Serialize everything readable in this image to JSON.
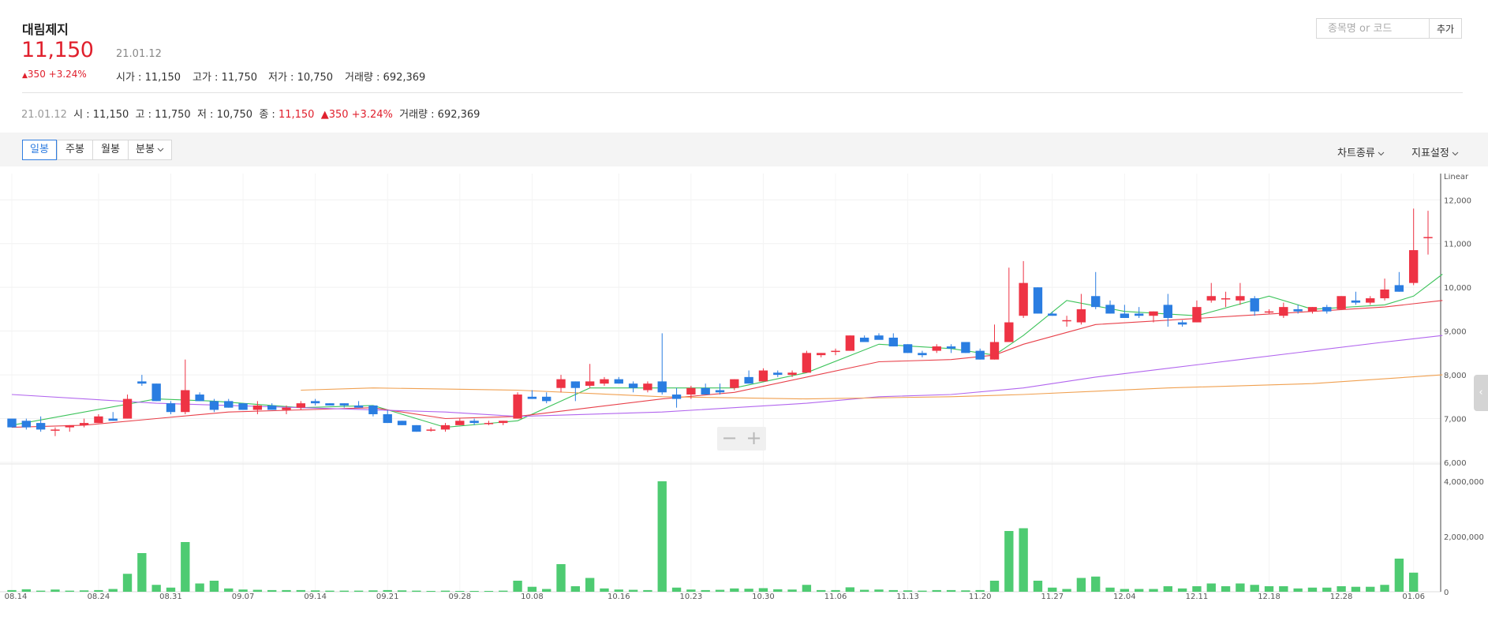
{
  "header": {
    "stock_name": "대림제지",
    "price": "11,150",
    "date": "21.01.12",
    "change_arrow": "▲",
    "change_text": "350 +3.24%",
    "stats": [
      {
        "label": "시가",
        "value": "11,150"
      },
      {
        "label": "고가",
        "value": "11,750"
      },
      {
        "label": "저가",
        "value": "10,750"
      },
      {
        "label": "거래량",
        "value": "692,369"
      }
    ]
  },
  "search": {
    "placeholder": "종목명 or 코드",
    "value": "",
    "add_label": "추가"
  },
  "quote_line": {
    "date": "21.01.12",
    "open_label": "시",
    "open": "11,150",
    "high_label": "고",
    "high": "11,750",
    "low_label": "저",
    "low": "10,750",
    "close_label": "종",
    "close": "11,150",
    "arrow": "▲",
    "change": "350 +3.24%",
    "volume_label": "거래량",
    "volume": "692,369"
  },
  "toolbar": {
    "periods": [
      "일봉",
      "주봉",
      "월봉",
      "분봉"
    ],
    "active_period": "일봉",
    "chart_type_label": "차트종류",
    "indicator_label": "지표설정"
  },
  "colors": {
    "up": "#ee3344",
    "down": "#2a7de1",
    "ma5": "#3cc35a",
    "ma20": "#e8404a",
    "ma60": "#b266ee",
    "ma120": "#f0a050",
    "volume": "#4ecb72",
    "active": "#2f7de1"
  },
  "icons": {
    "dropdown": "chevron-down-icon",
    "zoom_out": "minus-icon",
    "zoom_in": "plus-icon",
    "side": "chevron-left-icon"
  },
  "zoom": {
    "minus": "−",
    "plus": "+"
  },
  "side_handle": "‹",
  "chart_data": {
    "type": "candlestick",
    "scale_label": "Linear",
    "price_axis": {
      "min": 6000,
      "max": 12600,
      "ticks": [
        "12,000",
        "11,000",
        "10,000",
        "9,000",
        "8,000",
        "7,000",
        "6,000"
      ]
    },
    "volume_axis": {
      "min": 0,
      "max": 4000000,
      "ticks": [
        "4,000,000",
        "2,000,000",
        "0"
      ]
    },
    "x_ticks": [
      "08.14",
      "08.24",
      "08.31",
      "09.07",
      "09.14",
      "09.21",
      "09.28",
      "10.08",
      "10.16",
      "10.23",
      "10.30",
      "11.06",
      "11.13",
      "11.20",
      "11.27",
      "12.04",
      "12.11",
      "12.18",
      "12.28",
      "01.06"
    ],
    "x_tick_index": [
      0,
      6,
      11,
      16,
      21,
      26,
      31,
      36,
      42,
      47,
      52,
      57,
      62,
      67,
      72,
      77,
      82,
      87,
      92,
      97
    ],
    "candles": [
      [
        7000,
        7000,
        6800,
        6800
      ],
      [
        6950,
        7000,
        6750,
        6800
      ],
      [
        6900,
        7050,
        6700,
        6750
      ],
      [
        6750,
        6800,
        6600,
        6750
      ],
      [
        6800,
        6850,
        6700,
        6850
      ],
      [
        6850,
        7000,
        6800,
        6900
      ],
      [
        6900,
        7100,
        6900,
        7050
      ],
      [
        7000,
        7150,
        6950,
        6950
      ],
      [
        7000,
        7550,
        7000,
        7450
      ],
      [
        7850,
        8000,
        7750,
        7800
      ],
      [
        7800,
        7800,
        7400,
        7400
      ],
      [
        7350,
        7400,
        7100,
        7150
      ],
      [
        7150,
        8350,
        7100,
        7650
      ],
      [
        7550,
        7600,
        7400,
        7400
      ],
      [
        7400,
        7450,
        7150,
        7200
      ],
      [
        7400,
        7450,
        7250,
        7250
      ],
      [
        7350,
        7350,
        7200,
        7200
      ],
      [
        7200,
        7400,
        7100,
        7300
      ],
      [
        7300,
        7350,
        7200,
        7200
      ],
      [
        7200,
        7300,
        7100,
        7250
      ],
      [
        7250,
        7400,
        7200,
        7350
      ],
      [
        7400,
        7450,
        7300,
        7350
      ],
      [
        7350,
        7350,
        7300,
        7300
      ],
      [
        7350,
        7350,
        7250,
        7300
      ],
      [
        7300,
        7400,
        7250,
        7250
      ],
      [
        7300,
        7300,
        7050,
        7100
      ],
      [
        7100,
        7200,
        6900,
        6900
      ],
      [
        6950,
        6950,
        6850,
        6850
      ],
      [
        6850,
        6850,
        6700,
        6700
      ],
      [
        6750,
        6800,
        6700,
        6750
      ],
      [
        6750,
        6900,
        6700,
        6850
      ],
      [
        6850,
        7000,
        6850,
        6950
      ],
      [
        6950,
        7000,
        6850,
        6900
      ],
      [
        6900,
        6950,
        6850,
        6900
      ],
      [
        6900,
        6950,
        6850,
        6950
      ],
      [
        7000,
        7600,
        7000,
        7550
      ],
      [
        7500,
        7650,
        7450,
        7450
      ],
      [
        7500,
        7600,
        7350,
        7400
      ],
      [
        7700,
        8000,
        7600,
        7900
      ],
      [
        7850,
        7850,
        7400,
        7700
      ],
      [
        7750,
        8250,
        7700,
        7850
      ],
      [
        7800,
        7950,
        7750,
        7900
      ],
      [
        7900,
        7950,
        7800,
        7800
      ],
      [
        7800,
        7850,
        7600,
        7700
      ],
      [
        7650,
        7850,
        7600,
        7800
      ],
      [
        7850,
        8950,
        7550,
        7600
      ],
      [
        7550,
        7700,
        7250,
        7450
      ],
      [
        7550,
        7750,
        7450,
        7700
      ],
      [
        7700,
        7800,
        7550,
        7550
      ],
      [
        7650,
        7800,
        7550,
        7600
      ],
      [
        7700,
        7900,
        7650,
        7900
      ],
      [
        7950,
        8100,
        7800,
        7800
      ],
      [
        7850,
        8150,
        7850,
        8100
      ],
      [
        8050,
        8100,
        7950,
        8000
      ],
      [
        8000,
        8100,
        7950,
        8050
      ],
      [
        8050,
        8550,
        8050,
        8500
      ],
      [
        8450,
        8500,
        8400,
        8500
      ],
      [
        8550,
        8600,
        8450,
        8550
      ],
      [
        8550,
        8900,
        8550,
        8900
      ],
      [
        8850,
        8900,
        8750,
        8750
      ],
      [
        8900,
        8950,
        8850,
        8800
      ],
      [
        8850,
        8950,
        8650,
        8650
      ],
      [
        8700,
        8700,
        8500,
        8500
      ],
      [
        8500,
        8550,
        8400,
        8450
      ],
      [
        8550,
        8700,
        8500,
        8650
      ],
      [
        8650,
        8700,
        8500,
        8600
      ],
      [
        8750,
        8750,
        8500,
        8500
      ],
      [
        8550,
        8600,
        8350,
        8350
      ],
      [
        8350,
        9150,
        8350,
        8750
      ],
      [
        8750,
        10450,
        8750,
        9200
      ],
      [
        9350,
        10600,
        9300,
        10100
      ],
      [
        10000,
        10000,
        9400,
        9400
      ],
      [
        9400,
        9450,
        9350,
        9350
      ],
      [
        9250,
        9350,
        9100,
        9250
      ],
      [
        9200,
        9850,
        9150,
        9500
      ],
      [
        9800,
        10350,
        9500,
        9550
      ],
      [
        9600,
        9700,
        9400,
        9400
      ],
      [
        9400,
        9600,
        9350,
        9300
      ],
      [
        9400,
        9550,
        9300,
        9350
      ],
      [
        9350,
        9450,
        9200,
        9450
      ],
      [
        9600,
        9850,
        9100,
        9300
      ],
      [
        9200,
        9250,
        9100,
        9150
      ],
      [
        9200,
        9700,
        9200,
        9550
      ],
      [
        9700,
        10100,
        9650,
        9800
      ],
      [
        9750,
        9900,
        9550,
        9750
      ],
      [
        9700,
        10100,
        9600,
        9800
      ],
      [
        9750,
        9800,
        9350,
        9450
      ],
      [
        9450,
        9500,
        9400,
        9450
      ],
      [
        9350,
        9650,
        9300,
        9550
      ],
      [
        9500,
        9600,
        9400,
        9450
      ],
      [
        9450,
        9550,
        9400,
        9550
      ],
      [
        9550,
        9600,
        9400,
        9450
      ],
      [
        9500,
        9800,
        9500,
        9800
      ],
      [
        9700,
        9900,
        9600,
        9650
      ],
      [
        9650,
        9800,
        9600,
        9750
      ],
      [
        9750,
        10200,
        9700,
        9950
      ],
      [
        10050,
        10350,
        9900,
        9900
      ],
      [
        10100,
        11800,
        10050,
        10850
      ],
      [
        11150,
        11750,
        10750,
        11150
      ]
    ],
    "volumes": [
      60000,
      90000,
      40000,
      80000,
      40000,
      50000,
      60000,
      100000,
      650000,
      1400000,
      250000,
      150000,
      1800000,
      300000,
      400000,
      120000,
      80000,
      70000,
      60000,
      60000,
      60000,
      50000,
      40000,
      40000,
      40000,
      50000,
      60000,
      50000,
      40000,
      30000,
      40000,
      30000,
      30000,
      30000,
      40000,
      400000,
      180000,
      100000,
      1000000,
      200000,
      500000,
      120000,
      80000,
      70000,
      60000,
      4000000,
      150000,
      80000,
      60000,
      70000,
      120000,
      110000,
      130000,
      90000,
      80000,
      250000,
      60000,
      60000,
      160000,
      70000,
      80000,
      60000,
      50000,
      40000,
      60000,
      60000,
      50000,
      60000,
      400000,
      2200000,
      2300000,
      400000,
      150000,
      100000,
      500000,
      550000,
      150000,
      100000,
      100000,
      100000,
      200000,
      120000,
      200000,
      300000,
      200000,
      300000,
      250000,
      200000,
      200000,
      120000,
      150000,
      150000,
      200000,
      180000,
      180000,
      250000,
      1200000,
      692369
    ],
    "ma": {
      "ma5": {
        "start": 0,
        "points": [
          [
            0,
            6850
          ],
          [
            10,
            7450
          ],
          [
            14,
            7400
          ],
          [
            20,
            7250
          ],
          [
            25,
            7300
          ],
          [
            30,
            6800
          ],
          [
            35,
            6950
          ],
          [
            40,
            7700
          ],
          [
            45,
            7700
          ],
          [
            50,
            7700
          ],
          [
            55,
            8050
          ],
          [
            60,
            8700
          ],
          [
            65,
            8600
          ],
          [
            68,
            8450
          ],
          [
            70,
            8900
          ],
          [
            73,
            9700
          ],
          [
            77,
            9450
          ],
          [
            82,
            9350
          ],
          [
            87,
            9800
          ],
          [
            90,
            9500
          ],
          [
            95,
            9600
          ],
          [
            97,
            9800
          ],
          [
            99,
            10300
          ]
        ]
      },
      "ma20": {
        "start": 0,
        "points": [
          [
            0,
            6800
          ],
          [
            5,
            6850
          ],
          [
            10,
            7000
          ],
          [
            15,
            7150
          ],
          [
            20,
            7200
          ],
          [
            25,
            7250
          ],
          [
            30,
            7000
          ],
          [
            35,
            7050
          ],
          [
            40,
            7250
          ],
          [
            45,
            7450
          ],
          [
            50,
            7600
          ],
          [
            55,
            7950
          ],
          [
            60,
            8300
          ],
          [
            65,
            8350
          ],
          [
            68,
            8450
          ],
          [
            70,
            8700
          ],
          [
            75,
            9150
          ],
          [
            80,
            9250
          ],
          [
            85,
            9350
          ],
          [
            90,
            9450
          ],
          [
            95,
            9550
          ],
          [
            99,
            9700
          ]
        ]
      },
      "ma60": {
        "start": 0,
        "points": [
          [
            0,
            7550
          ],
          [
            10,
            7350
          ],
          [
            20,
            7250
          ],
          [
            30,
            7150
          ],
          [
            35,
            7050
          ],
          [
            45,
            7150
          ],
          [
            55,
            7350
          ],
          [
            60,
            7500
          ],
          [
            65,
            7550
          ],
          [
            70,
            7700
          ],
          [
            75,
            7950
          ],
          [
            80,
            8150
          ],
          [
            85,
            8350
          ],
          [
            90,
            8550
          ],
          [
            95,
            8750
          ],
          [
            99,
            8900
          ]
        ]
      },
      "ma120": {
        "start": 20,
        "points": [
          [
            20,
            7650
          ],
          [
            25,
            7700
          ],
          [
            35,
            7650
          ],
          [
            45,
            7500
          ],
          [
            55,
            7450
          ],
          [
            65,
            7500
          ],
          [
            70,
            7550
          ],
          [
            80,
            7700
          ],
          [
            90,
            7800
          ],
          [
            99,
            8000
          ]
        ]
      }
    }
  }
}
